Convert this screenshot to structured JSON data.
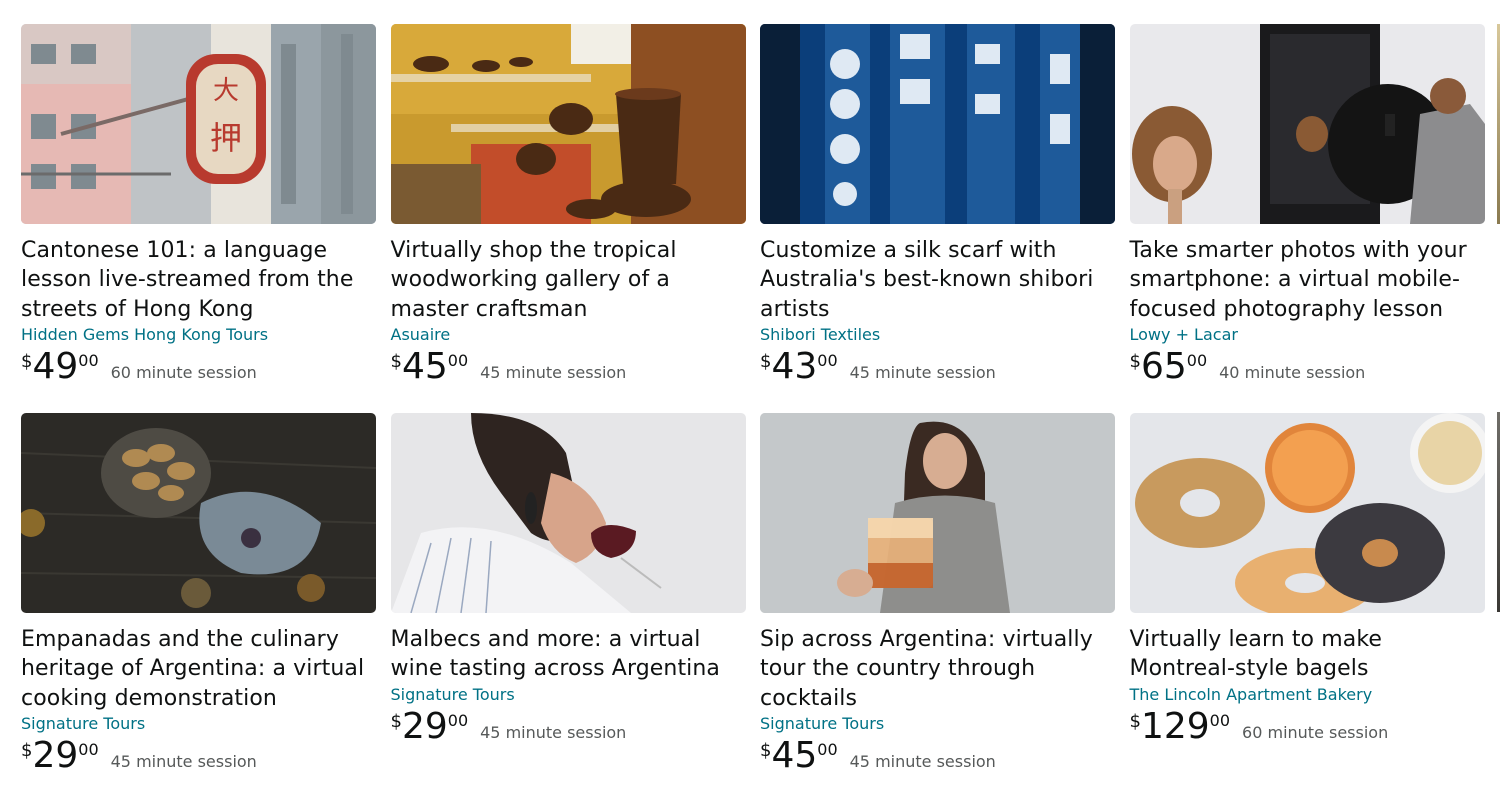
{
  "cards": [
    {
      "title": "Cantonese 101: a language lesson live-streamed from the streets of Hong Kong",
      "seller": "Hidden Gems Hong Kong Tours",
      "price": {
        "symbol": "$",
        "whole": "49",
        "fraction": "00"
      },
      "session": "60 minute session",
      "image_icon": "hong-kong-street-sign-image"
    },
    {
      "title": "Virtually shop the tropical woodworking gallery of a master craftsman",
      "seller": "Asuaire",
      "price": {
        "symbol": "$",
        "whole": "45",
        "fraction": "00"
      },
      "session": "45 minute session",
      "image_icon": "wooden-bowls-gallery-image"
    },
    {
      "title": "Customize a silk scarf with Australia's best-known shibori artists",
      "seller": "Shibori Textiles",
      "price": {
        "symbol": "$",
        "whole": "43",
        "fraction": "00"
      },
      "session": "45 minute session",
      "image_icon": "shibori-scarf-image"
    },
    {
      "title": "Take smarter photos with your smartphone: a virtual mobile-focused photography lesson",
      "seller": "Lowy + Lacar",
      "price": {
        "symbol": "$",
        "whole": "65",
        "fraction": "00"
      },
      "session": "40 minute session",
      "image_icon": "photo-studio-image"
    },
    {
      "title": "Empanadas and the culinary heritage of Argentina: a virtual cooking demonstration",
      "seller": "Signature Tours",
      "price": {
        "symbol": "$",
        "whole": "29",
        "fraction": "00"
      },
      "session": "45 minute session",
      "image_icon": "empanadas-image"
    },
    {
      "title": "Malbecs and more: a virtual wine tasting across Argentina",
      "seller": "Signature Tours",
      "price": {
        "symbol": "$",
        "whole": "29",
        "fraction": "00"
      },
      "session": "45 minute session",
      "image_icon": "wine-tasting-image"
    },
    {
      "title": "Sip across Argentina: virtually tour the country through cocktails",
      "seller": "Signature Tours",
      "price": {
        "symbol": "$",
        "whole": "45",
        "fraction": "00"
      },
      "session": "45 minute session",
      "image_icon": "cocktail-image"
    },
    {
      "title": "Virtually learn to make Montreal-style bagels",
      "seller": "The Lincoln Apartment Bakery",
      "price": {
        "symbol": "$",
        "whole": "129",
        "fraction": "00"
      },
      "session": "60 minute session",
      "image_icon": "bagels-image"
    }
  ],
  "colors": {
    "seller_link": "#007185",
    "title_text": "#0f1111",
    "session_text": "#565959"
  }
}
